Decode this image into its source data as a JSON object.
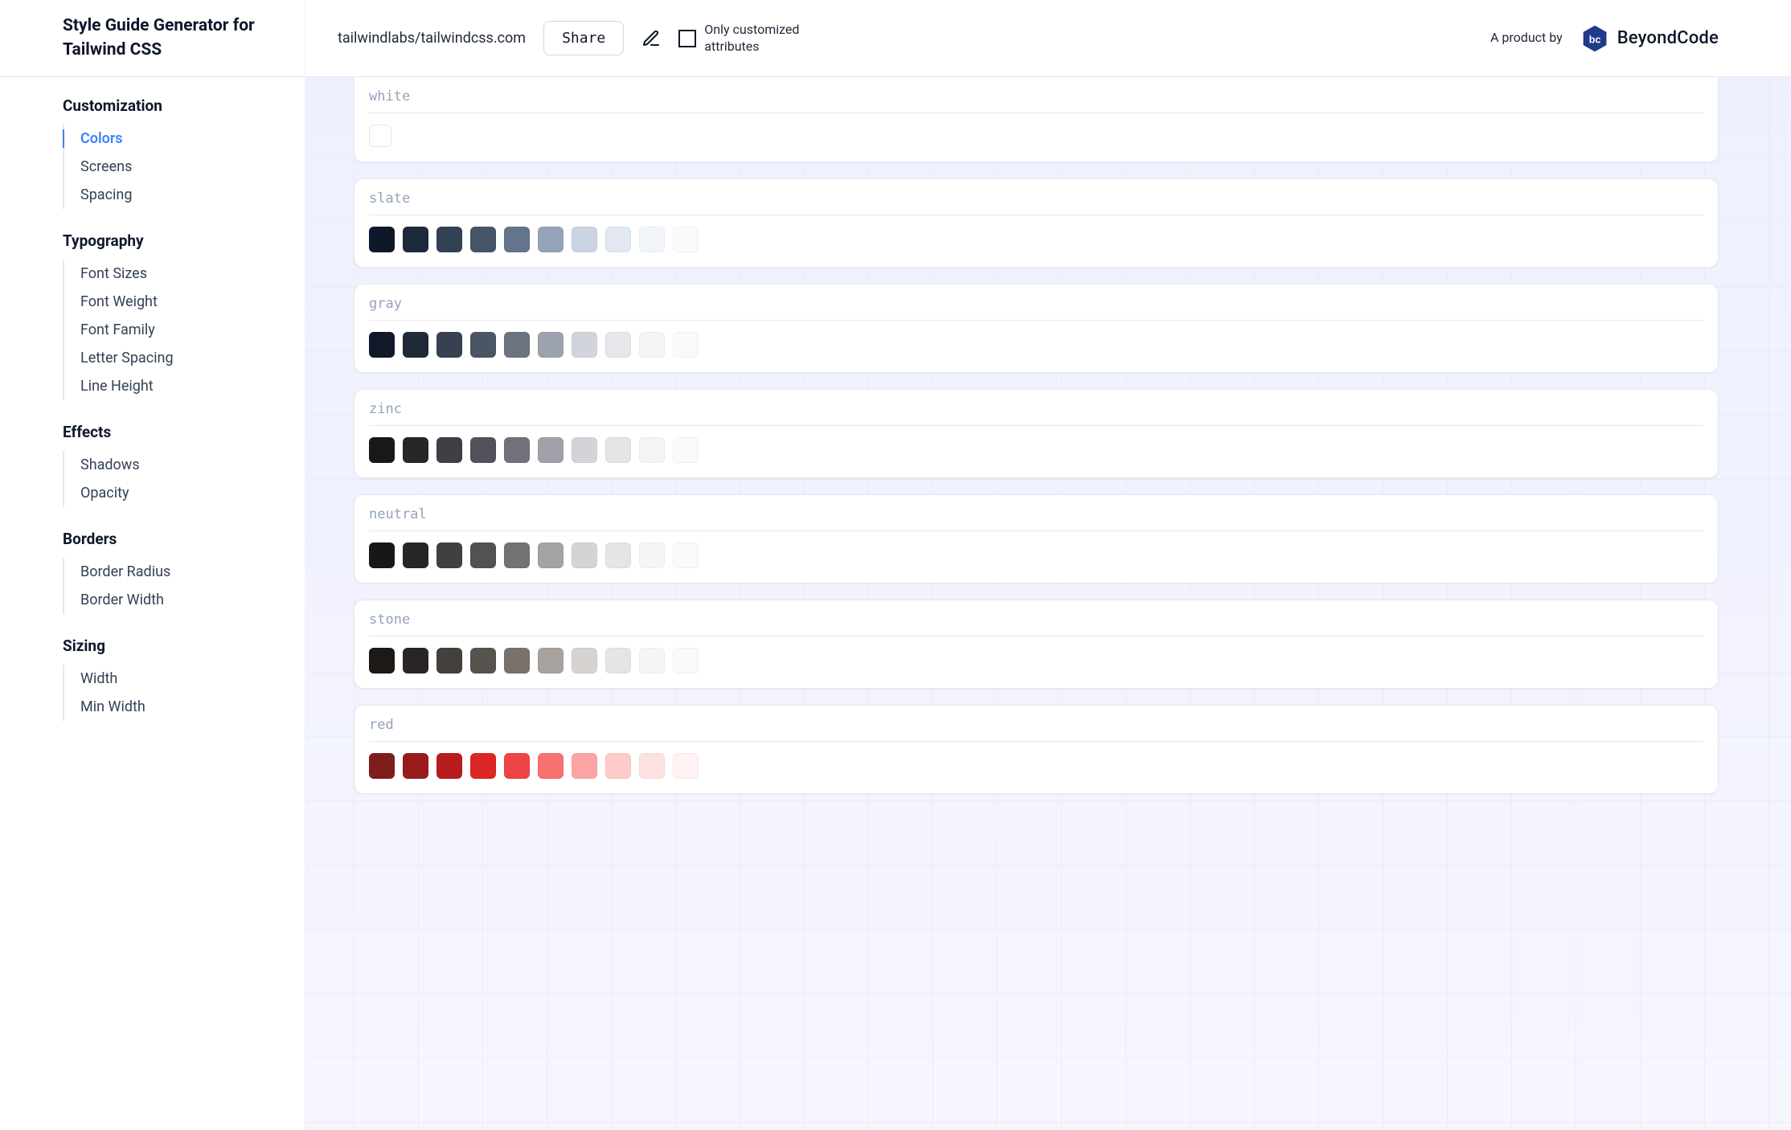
{
  "header": {
    "title": "Style Guide Generator for Tailwind CSS",
    "repo": "tailwindlabs/tailwindcss.com",
    "share_label": "Share",
    "only_customized_label": "Only customized attributes",
    "product_by": "A product by",
    "brand_name": "BeyondCode"
  },
  "sidebar": {
    "sections": [
      {
        "heading": "Customization",
        "items": [
          {
            "label": "Colors",
            "active": true
          },
          {
            "label": "Screens"
          },
          {
            "label": "Spacing"
          }
        ]
      },
      {
        "heading": "Typography",
        "items": [
          {
            "label": "Font Sizes"
          },
          {
            "label": "Font Weight"
          },
          {
            "label": "Font Family"
          },
          {
            "label": "Letter Spacing"
          },
          {
            "label": "Line Height"
          }
        ]
      },
      {
        "heading": "Effects",
        "items": [
          {
            "label": "Shadows"
          },
          {
            "label": "Opacity"
          }
        ]
      },
      {
        "heading": "Borders",
        "items": [
          {
            "label": "Border Radius"
          },
          {
            "label": "Border Width"
          }
        ]
      },
      {
        "heading": "Sizing",
        "items": [
          {
            "label": "Width"
          },
          {
            "label": "Min Width"
          }
        ]
      }
    ]
  },
  "palettes": [
    {
      "name": "white",
      "swatches": [
        "#ffffff"
      ]
    },
    {
      "name": "slate",
      "swatches": [
        "#0f172a",
        "#1e293b",
        "#334155",
        "#475569",
        "#64748b",
        "#94a3b8",
        "#cbd5e1",
        "#e2e8f0",
        "#f1f5f9",
        "#f8fafc"
      ]
    },
    {
      "name": "gray",
      "swatches": [
        "#111827",
        "#1f2937",
        "#374151",
        "#4b5563",
        "#6b7280",
        "#9ca3af",
        "#d1d5db",
        "#e5e7eb",
        "#f3f4f6",
        "#f9fafb"
      ]
    },
    {
      "name": "zinc",
      "swatches": [
        "#18181b",
        "#27272a",
        "#3f3f46",
        "#52525b",
        "#71717a",
        "#a1a1aa",
        "#d4d4d8",
        "#e4e4e7",
        "#f4f4f5",
        "#fafafa"
      ]
    },
    {
      "name": "neutral",
      "swatches": [
        "#171717",
        "#262626",
        "#404040",
        "#525252",
        "#737373",
        "#a3a3a3",
        "#d4d4d4",
        "#e5e5e5",
        "#f5f5f5",
        "#fafafa"
      ]
    },
    {
      "name": "stone",
      "swatches": [
        "#1c1917",
        "#292524",
        "#44403c",
        "#57534e",
        "#78716c",
        "#a8a29e",
        "#d6d3d1",
        "#e7e5e4",
        "#f5f5f4",
        "#fafaf9"
      ]
    },
    {
      "name": "red",
      "swatches": [
        "#7f1d1d",
        "#991b1b",
        "#b91c1c",
        "#dc2626",
        "#ef4444",
        "#f87171",
        "#fca5a5",
        "#fecaca",
        "#fee2e2",
        "#fef2f2"
      ]
    }
  ]
}
